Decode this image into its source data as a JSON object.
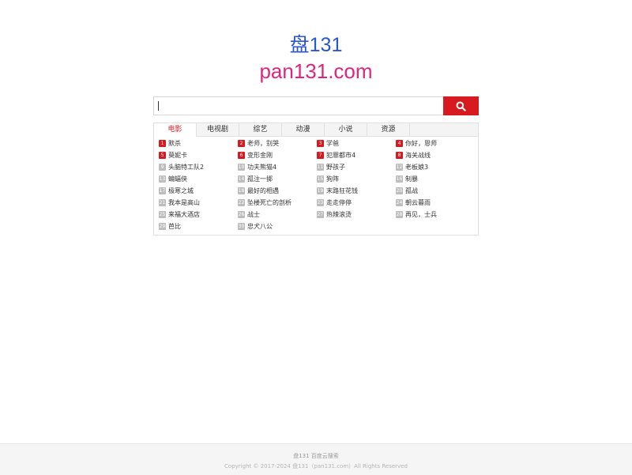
{
  "logo": {
    "line1": "盘131",
    "line2": "pan131.com",
    "line1_color": "#2b55d9",
    "line2_color": "#e0257c"
  },
  "search": {
    "value": "",
    "placeholder": "",
    "button_icon": "search-icon",
    "button_color": "#d71920"
  },
  "tabs": [
    {
      "label": "电影",
      "active": true
    },
    {
      "label": "电视剧"
    },
    {
      "label": "综艺"
    },
    {
      "label": "动漫"
    },
    {
      "label": "小说"
    },
    {
      "label": "资源"
    }
  ],
  "list": [
    {
      "rank": "1",
      "title": "默杀"
    },
    {
      "rank": "2",
      "title": "老师，别哭"
    },
    {
      "rank": "3",
      "title": "学爸"
    },
    {
      "rank": "4",
      "title": "你好，恩师"
    },
    {
      "rank": "5",
      "title": "莫妮卡"
    },
    {
      "rank": "6",
      "title": "变形金刚"
    },
    {
      "rank": "7",
      "title": "犯罪都市4"
    },
    {
      "rank": "8",
      "title": "海关战线"
    },
    {
      "rank": "9",
      "title": "头脑特工队2"
    },
    {
      "rank": "10",
      "title": "功夫熊猫4"
    },
    {
      "rank": "11",
      "title": "野孩子"
    },
    {
      "rank": "12",
      "title": "老板娘3"
    },
    {
      "rank": "13",
      "title": "蝙蝠侠"
    },
    {
      "rank": "14",
      "title": "孤注一掷"
    },
    {
      "rank": "15",
      "title": "狗阵"
    },
    {
      "rank": "16",
      "title": "制暴"
    },
    {
      "rank": "17",
      "title": "极寒之城"
    },
    {
      "rank": "18",
      "title": "最好的相遇"
    },
    {
      "rank": "19",
      "title": "末路狂花钱"
    },
    {
      "rank": "20",
      "title": "孤战"
    },
    {
      "rank": "21",
      "title": "我本是高山"
    },
    {
      "rank": "22",
      "title": "坠楼死亡的剖析"
    },
    {
      "rank": "23",
      "title": "走走停停"
    },
    {
      "rank": "24",
      "title": "朝云暮雨"
    },
    {
      "rank": "25",
      "title": "来福大酒店"
    },
    {
      "rank": "26",
      "title": "战士"
    },
    {
      "rank": "27",
      "title": "热辣滚烫"
    },
    {
      "rank": "28",
      "title": "再见，士兵"
    },
    {
      "rank": "29",
      "title": "芭比"
    },
    {
      "rank": "30",
      "title": "忠犬八公"
    }
  ],
  "footer": {
    "line1": "盘131 百度云搜索",
    "line2": "Copyright © 2017-2024 盘131（pan131.com）All Rights Reserved"
  },
  "colors": {
    "accent": "#d71920",
    "rank_default": "#bdbdbd"
  }
}
